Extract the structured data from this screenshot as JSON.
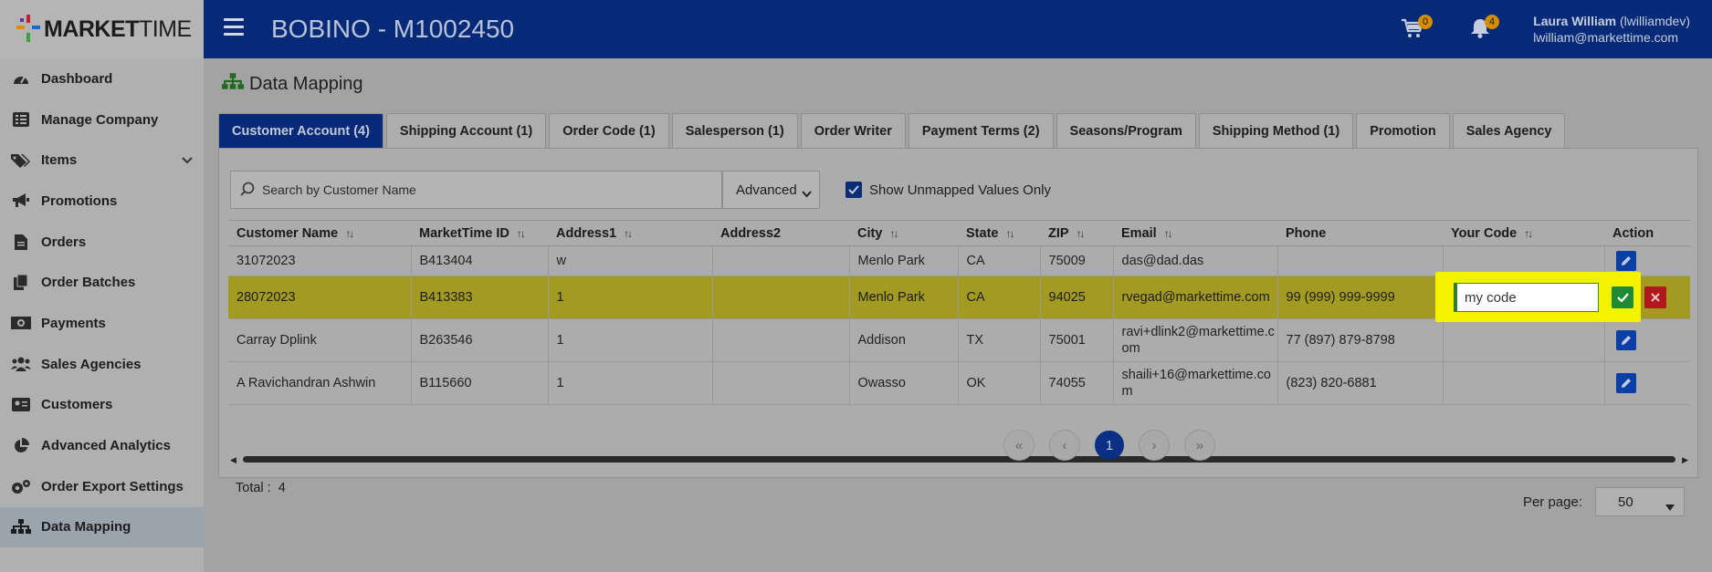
{
  "app": {
    "logo_bold": "MARKET",
    "logo_thin": "TIME",
    "page_title": "BOBINO - M1002450",
    "cart_count": "0",
    "notif_count": "4",
    "user_name": "Laura William",
    "user_login": "(lwilliamdev)",
    "user_email": "lwilliam@markettime.com"
  },
  "sidebar": {
    "items": [
      {
        "label": "Dashboard",
        "icon": "gauge-icon"
      },
      {
        "label": "Manage Company",
        "icon": "list-icon"
      },
      {
        "label": "Items",
        "icon": "tags-icon"
      },
      {
        "label": "Promotions",
        "icon": "megaphone-icon"
      },
      {
        "label": "Orders",
        "icon": "document-icon"
      },
      {
        "label": "Order Batches",
        "icon": "copy-icon"
      },
      {
        "label": "Payments",
        "icon": "money-icon"
      },
      {
        "label": "Sales Agencies",
        "icon": "users-icon"
      },
      {
        "label": "Customers",
        "icon": "id-card-icon"
      },
      {
        "label": "Advanced Analytics",
        "icon": "pie-chart-icon"
      },
      {
        "label": "Order Export Settings",
        "icon": "gears-icon"
      },
      {
        "label": "Data Mapping",
        "icon": "sitemap-icon"
      }
    ]
  },
  "main": {
    "title": "Data Mapping",
    "tabs": [
      "Customer Account (4)",
      "Shipping Account (1)",
      "Order Code (1)",
      "Salesperson (1)",
      "Order Writer",
      "Payment Terms (2)",
      "Seasons/Program",
      "Shipping Method (1)",
      "Promotion",
      "Sales Agency"
    ],
    "search_placeholder": "Search by Customer Name",
    "advanced_label": "Advanced",
    "show_unmapped_label": "Show Unmapped Values Only",
    "columns": [
      "Customer Name",
      "MarketTime ID",
      "Address1",
      "Address2",
      "City",
      "State",
      "ZIP",
      "Email",
      "Phone",
      "Your Code",
      "Action"
    ],
    "rows": [
      {
        "name": "31072023",
        "mt_id": "B413404",
        "addr1": "w",
        "addr2": "",
        "city": "Menlo Park",
        "state": "CA",
        "zip": "75009",
        "email": "das@dad.das",
        "phone": "",
        "code": ""
      },
      {
        "name": "28072023",
        "mt_id": "B413383",
        "addr1": "1",
        "addr2": "",
        "city": "Menlo Park",
        "state": "CA",
        "zip": "94025",
        "email": "rvegad@markettime.com",
        "phone": "99 (999) 999-9999",
        "code": "my code"
      },
      {
        "name": "Carray Dplink",
        "mt_id": "B263546",
        "addr1": "1",
        "addr2": "",
        "city": "Addison",
        "state": "TX",
        "zip": "75001",
        "email": "ravi+dlink2@markettime.com",
        "phone": "77 (897) 879-8798",
        "code": ""
      },
      {
        "name": "A Ravichandran Ashwin",
        "mt_id": "B115660",
        "addr1": "1",
        "addr2": "",
        "city": "Owasso",
        "state": "OK",
        "zip": "74055",
        "email": "shaili+16@markettime.com",
        "phone": "(823) 820-6881",
        "code": ""
      }
    ],
    "total_label": "Total :",
    "total_value": "4",
    "pager": {
      "first": "«",
      "prev": "‹",
      "current": "1",
      "next": "›",
      "last": "»"
    },
    "per_page_label": "Per page:",
    "per_page_value": "50"
  },
  "colors": {
    "brand": "#062a78",
    "highlight": "#f5f200",
    "ok": "#1d8a34",
    "cancel": "#b0181c"
  }
}
